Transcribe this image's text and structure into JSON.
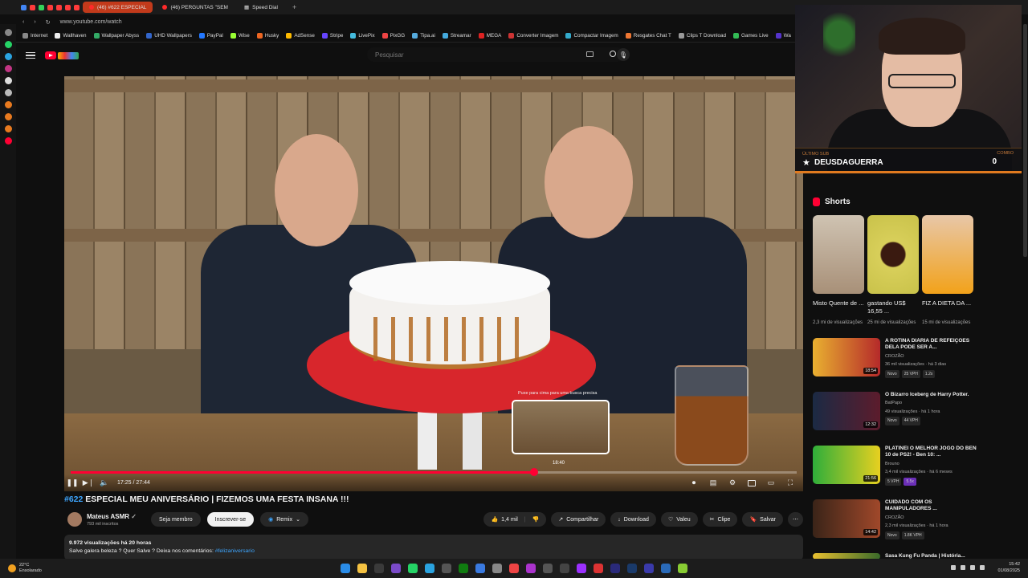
{
  "browser": {
    "tabs": [
      {
        "label": "(46) #622 ESPECIAL",
        "active": true
      },
      {
        "label": "(46) PERGUNTAS \"SEM",
        "active": false
      },
      {
        "label": "Speed Dial",
        "active": false
      }
    ],
    "url": "www.youtube.com/watch",
    "bookmarks": [
      "Internet",
      "Wallhaven",
      "Wallpaper Abyss",
      "UHD Wallpapers",
      "PayPal",
      "Wise",
      "Husky",
      "AdSense",
      "Stripe",
      "LivePix",
      "PixGG",
      "Tipa.ai",
      "Streamar",
      "MEGA",
      "Converter Imagem",
      "Compactar Imagem",
      "Resgates Chat T",
      "Clips T Download",
      "Games Live",
      "Wa"
    ]
  },
  "search": {
    "placeholder": "Pesquisar"
  },
  "player": {
    "time": "17:25 / 27:44",
    "preview_hint": "Puxe para cima para uma busca precisa",
    "preview_time": "18:40",
    "progress": 0.638
  },
  "video": {
    "tag": "#622",
    "title": "ESPECIAL MEU ANIVERSÁRIO | FIZEMOS UMA FESTA INSANA !!!",
    "channel": "Mateus ASMR",
    "subs": "793 mil inscritos",
    "join_label": "Seja membro",
    "subscribe_label": "Inscrever-se",
    "remix_label": "Remix",
    "likes": "1,4 mil",
    "share_label": "Compartilhar",
    "download_label": "Download",
    "thanks_label": "Valeu",
    "clip_label": "Clipe",
    "save_label": "Salvar",
    "views": "9.972 visualizações  há 20 horas",
    "description": "Salve galera beleza ? Quer Salve ? Deixa nos comentários:",
    "hashtag": "#felizaniversario"
  },
  "overlay": {
    "last_sub_label": "ÚLTIMO SUB",
    "last_sub_user": "DEUSDAGUERRA",
    "combo_label": "COMBO",
    "combo_value": "0"
  },
  "shorts": {
    "heading": "Shorts",
    "items": [
      {
        "title": "Misto Quente de ...",
        "views": "2,3 mi de visualizações"
      },
      {
        "title": "gastando US$ 16,55 ...",
        "views": "25 mi de visualizações"
      },
      {
        "title": "FIZ A DIETA DA ...",
        "views": "15 mi de visualizações"
      }
    ]
  },
  "recommended": [
    {
      "title": "A ROTINA DIÁRIA DE REFEIÇÕES DELA PODE SER A...",
      "channel": "CROZÃO",
      "meta": "36 mil visualizações · há 3 dias",
      "duration": "18:54",
      "badges": [
        "Novo",
        "25 VPH",
        "1.2x"
      ]
    },
    {
      "title": "O Bizarro Iceberg de Harry Potter.",
      "channel": "BatPapo",
      "meta": "49 visualizações · há 1 hora",
      "duration": "12:32",
      "badges": [
        "Novo",
        "44 VPH"
      ]
    },
    {
      "title": "PLATINEI O MELHOR JOGO DO BEN 10 de PS2! - Ben 10: ...",
      "channel": "Brouno",
      "meta": "3,4 mil visualizações · há 6 meses",
      "duration": "21:56",
      "badges": [
        "5 VPH",
        "5.5x"
      ]
    },
    {
      "title": "CUIDADO COM OS MANIPULADORES ...",
      "channel": "CROZÃO",
      "meta": "2,3 mil visualizações · há 1 hora",
      "duration": "14:42",
      "badges": [
        "Novo",
        "1.8K VPH"
      ]
    },
    {
      "title": "Sasa Kung Fu Panda | História...",
      "channel": "",
      "meta": "",
      "duration": "",
      "badges": []
    }
  ],
  "taskbar": {
    "temp": "22°C",
    "weather": "Ensolarado",
    "time": "15:42",
    "date": "01/08/2025"
  }
}
